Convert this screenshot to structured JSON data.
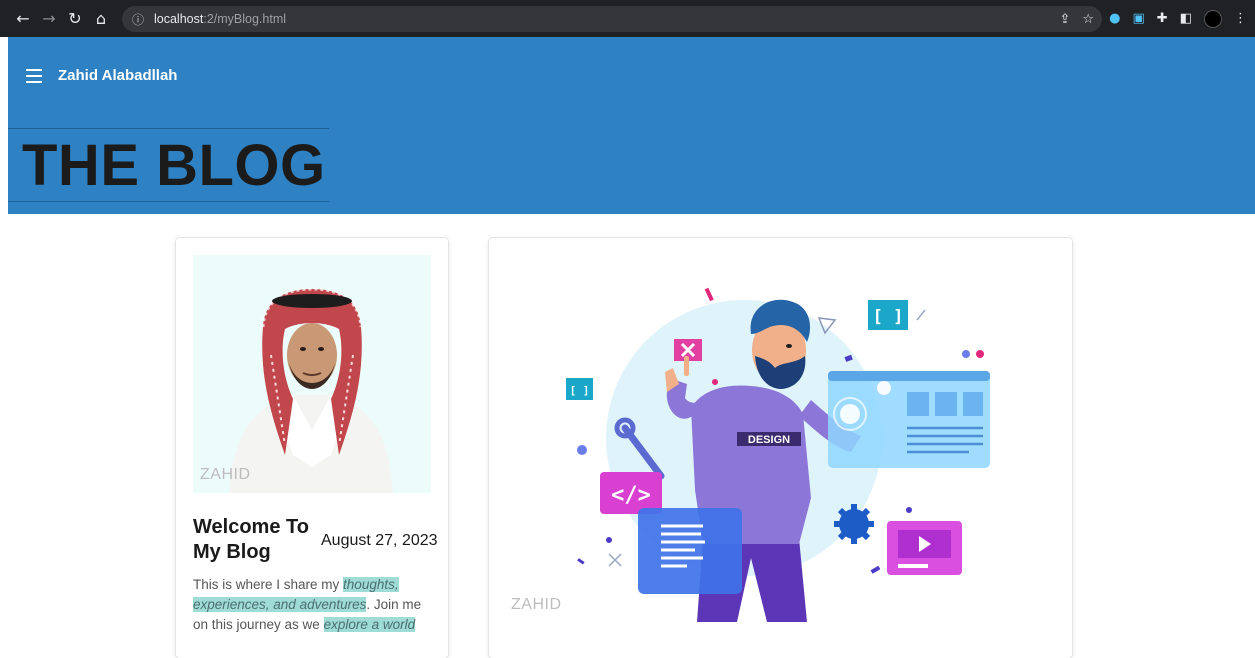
{
  "browser": {
    "url_host": "localhost",
    "url_path": ":2/myBlog.html"
  },
  "header": {
    "site_name": "Zahid Alabadllah",
    "title": "THE BLOG"
  },
  "profile_card": {
    "watermark": "ZAHID",
    "post_title": "Welcome To My Blog",
    "post_date": "August 27, 2023",
    "text_1": "This is where I share my ",
    "highlight_1": "thoughts, experiences, and adventures",
    "text_2": ". Join me on this journey as we ",
    "highlight_2": "explore a world"
  },
  "illustration_card": {
    "watermark": "ZAHID",
    "shirt_label": "DESIGN",
    "code_symbol": "</>",
    "bracket_symbol": "[ ]"
  },
  "colors": {
    "header_bg": "#2e82c4",
    "highlight": "#9fdcd6",
    "chrome_bg": "#202124"
  }
}
